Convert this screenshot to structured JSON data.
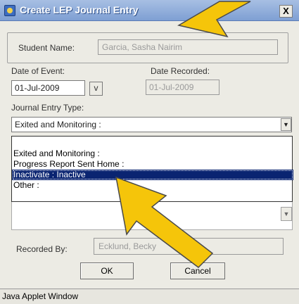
{
  "window": {
    "title": "Create LEP Journal Entry",
    "close_label": "X"
  },
  "form": {
    "student_name_label": "Student Name:",
    "student_name_value": "Garcia, Sasha Nairim",
    "date_of_event_label": "Date of Event:",
    "date_of_event_value": "01-Jul-2009",
    "date_picker_label": "v",
    "date_recorded_label": "Date Recorded:",
    "date_recorded_value": "01-Jul-2009",
    "journal_type_label": "Journal Entry Type:",
    "journal_type_value": "Exited and Monitoring :",
    "dropdown_options": [
      "",
      "Exited and Monitoring :",
      "Progress Report Sent Home :",
      "Inactivate : Inactive",
      "Other :"
    ],
    "selected_index": 3,
    "recorded_by_label": "Recorded By:",
    "recorded_by_value": "Ecklund, Becky"
  },
  "buttons": {
    "ok": "OK",
    "cancel": "Cancel"
  },
  "status_bar": "Java Applet Window",
  "colors": {
    "selection": "#0a2471",
    "arrow_fill": "#f5c50a",
    "title_bar": "#7e9fd3"
  }
}
